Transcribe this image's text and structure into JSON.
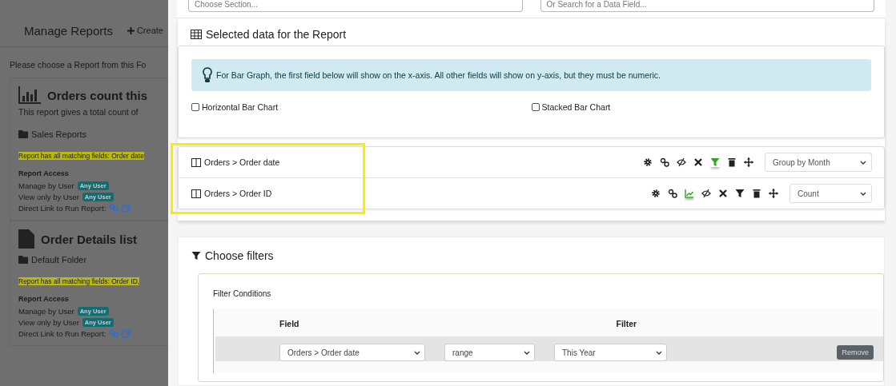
{
  "background": {
    "title": "Manage Reports",
    "create_link": "Create",
    "intro": "Please choose a Report from this Fo",
    "reports": [
      {
        "kind": "chart",
        "title": "Orders count this",
        "description": "This report gives a total count of",
        "folder": "Sales Reports",
        "match": "Report has all matching fields: Order date",
        "access_title": "Report Access",
        "manage_label": "Manage by User",
        "manage_badge": "Any User",
        "view_label": "View only by User",
        "view_badge": "Any User",
        "link_label": "Direct Link to Run Report:"
      },
      {
        "kind": "file",
        "title": "Order Details list",
        "folder": "Default Folder",
        "match": "Report has all matching fields: Order ID,",
        "access_title": "Report Access",
        "manage_label": "Manage by User",
        "manage_badge": "Any User",
        "view_label": "View only by User",
        "view_badge": "Any User",
        "link_label": "Direct Link to Run Report:"
      }
    ]
  },
  "section_field": {
    "placeholder": "Choose Section..."
  },
  "search_field": {
    "placeholder": "Or Search for a Data Field..."
  },
  "selected_data": {
    "title": "Selected data for the Report",
    "hint": "For Bar Graph, the first field below will show on the x-axis. All other fields will show on y-axis, but they must be numeric.",
    "options": [
      {
        "label": "Horizontal Bar Chart",
        "checked": false
      },
      {
        "label": "Stacked Bar Chart",
        "checked": false
      }
    ],
    "fields": [
      {
        "label": "Orders > Order date",
        "tools": [
          {
            "kind": "gear",
            "on": false
          },
          {
            "kind": "link",
            "on": false
          },
          {
            "kind": "hide",
            "on": false
          },
          {
            "kind": "remove",
            "on": false
          },
          {
            "kind": "filter",
            "on": true
          },
          {
            "kind": "trash",
            "on": false
          },
          {
            "kind": "move",
            "on": false
          }
        ],
        "value": "Group by Month"
      },
      {
        "label": "Orders > Order ID",
        "tools": [
          {
            "kind": "gear",
            "on": false
          },
          {
            "kind": "link",
            "on": false
          },
          {
            "kind": "chart",
            "on": true
          },
          {
            "kind": "hide",
            "on": false
          },
          {
            "kind": "remove",
            "on": false
          },
          {
            "kind": "filter",
            "on": false
          },
          {
            "kind": "trash",
            "on": false
          },
          {
            "kind": "move",
            "on": false
          }
        ],
        "value": "Count"
      }
    ]
  },
  "filters": {
    "title": "Choose filters",
    "group_label": "Filter Conditions",
    "columns": [
      "Field",
      "Filter"
    ],
    "rows": [
      {
        "field": "Orders > Order date",
        "operator": "range",
        "value": "This Year",
        "remove": "Remove"
      }
    ]
  }
}
